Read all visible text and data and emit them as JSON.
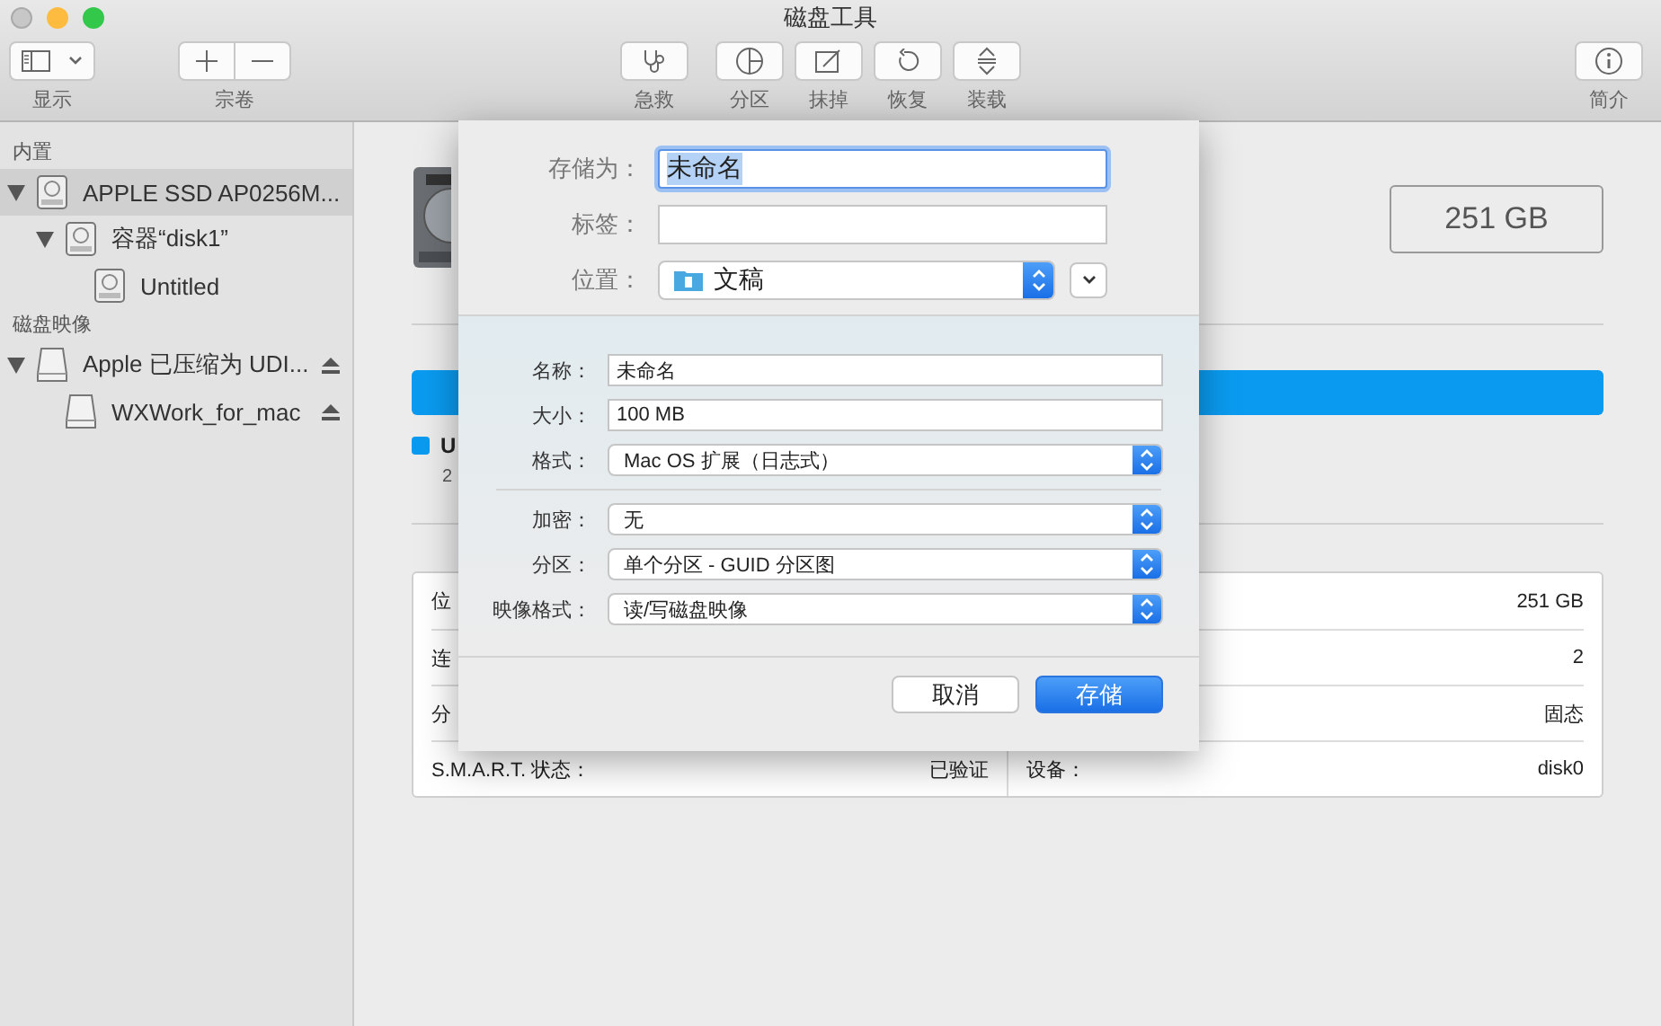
{
  "window": {
    "title": "磁盘工具"
  },
  "toolbar": [
    {
      "kind": "view",
      "label": "显示"
    },
    {
      "kind": "volume",
      "label": "宗卷"
    },
    {
      "kind": "firstaid",
      "label": "急救"
    },
    {
      "kind": "partition",
      "label": "分区"
    },
    {
      "kind": "erase",
      "label": "抹掉"
    },
    {
      "kind": "restore",
      "label": "恢复"
    },
    {
      "kind": "mount",
      "label": "装载"
    },
    {
      "kind": "info",
      "label": "简介"
    }
  ],
  "sidebar": [
    {
      "heading": "内置",
      "items": [
        {
          "label": "APPLE SSD AP0256M...",
          "kind": "internal",
          "selected": true,
          "expanded": true,
          "eject": false,
          "children": [
            {
              "label": "容器“disk1”",
              "kind": "internal",
              "selected": false,
              "expanded": true,
              "eject": false,
              "children": [
                {
                  "label": "Untitled",
                  "kind": "internal",
                  "selected": false,
                  "eject": false
                }
              ]
            }
          ]
        }
      ]
    },
    {
      "heading": "磁盘映像",
      "items": [
        {
          "label": "Apple 已压缩为 UDI...",
          "kind": "image",
          "selected": false,
          "expanded": true,
          "eject": true,
          "children": [
            {
              "label": "WXWork_for_mac",
              "kind": "image",
              "selected": false,
              "eject": true
            }
          ]
        }
      ]
    }
  ],
  "main": {
    "capacity": "251 GB",
    "usage_bar": {
      "level": 1.0
    },
    "legend": {
      "label": "U",
      "sub": "2",
      "color": "#0a9bf0"
    },
    "info_rows": [
      {
        "left_label": "位",
        "right_value": "251 GB"
      },
      {
        "left_label": "连",
        "right_value": "2"
      },
      {
        "left_label": "分",
        "right_value": "固态"
      },
      {
        "left_label": "S.M.A.R.T. 状态：",
        "left_value": "已验证",
        "right_label": "设备：",
        "right_value": "disk0"
      }
    ]
  },
  "dialog": {
    "top": [
      {
        "kind": "text",
        "label": "存储为：",
        "value": "未命名",
        "focused": true
      },
      {
        "kind": "text",
        "label": "标签：",
        "focused": false
      },
      {
        "kind": "location",
        "label": "位置：",
        "value": "文稿"
      }
    ],
    "groups": [
      [
        {
          "kind": "text",
          "label": "名称：",
          "value": "未命名"
        },
        {
          "kind": "text",
          "label": "大小：",
          "value": "100 MB"
        },
        {
          "kind": "popup",
          "label": "格式：",
          "value": "Mac OS 扩展（日志式）"
        }
      ],
      [
        {
          "kind": "popup",
          "label": "加密：",
          "value": "无"
        },
        {
          "kind": "popup",
          "label": "分区：",
          "value": "单个分区 - GUID 分区图"
        },
        {
          "kind": "popup",
          "label": "映像格式：",
          "value": "读/写磁盘映像"
        }
      ]
    ],
    "buttons": [
      {
        "label": "取消",
        "default": false
      },
      {
        "label": "存储",
        "default": true
      }
    ]
  }
}
